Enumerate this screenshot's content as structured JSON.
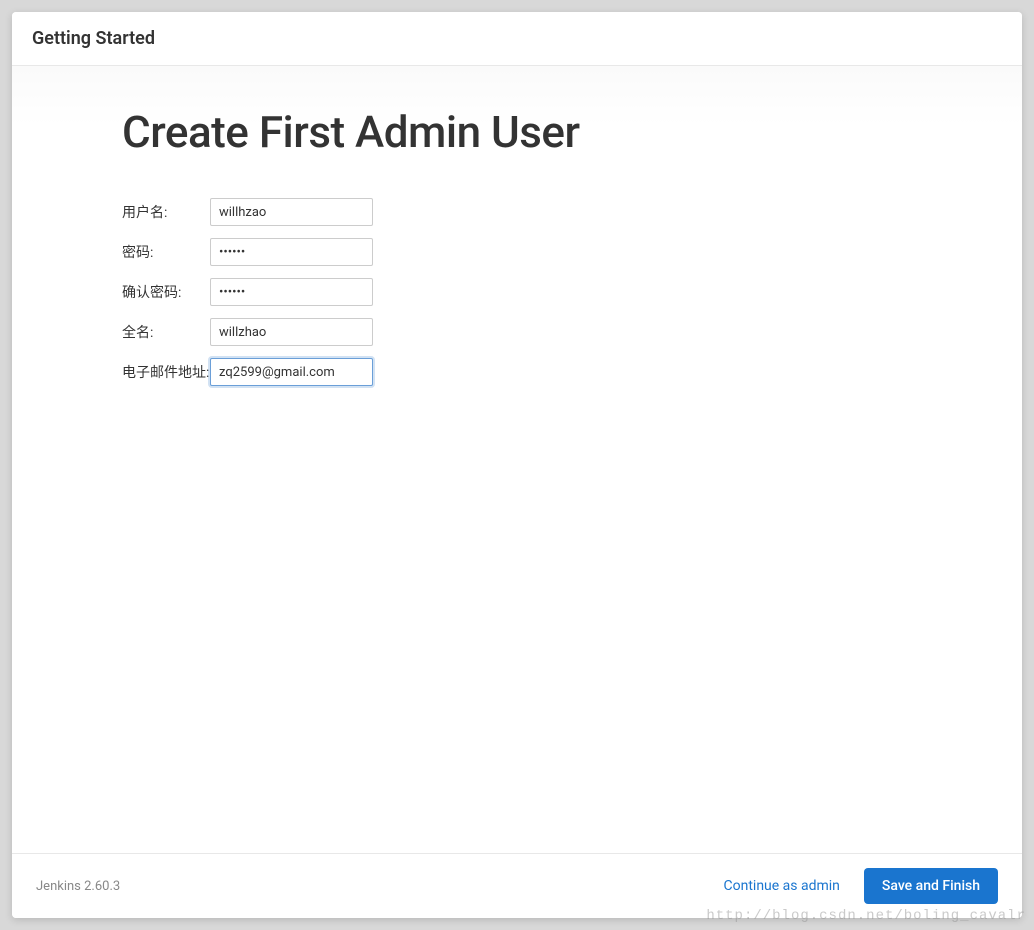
{
  "header": {
    "title": "Getting Started"
  },
  "main": {
    "title": "Create First Admin User",
    "fields": {
      "username": {
        "label": "用户名:",
        "value": "willhzao"
      },
      "password": {
        "label": "密码:",
        "value": "••••••"
      },
      "confirm_password": {
        "label": "确认密码:",
        "value": "••••••"
      },
      "fullname": {
        "label": "全名:",
        "value": "willzhao"
      },
      "email": {
        "label": "电子邮件地址:",
        "value": "zq2599@gmail.com"
      }
    }
  },
  "footer": {
    "version": "Jenkins 2.60.3",
    "continue_label": "Continue as admin",
    "save_label": "Save and Finish"
  },
  "watermark": "http://blog.csdn.net/boling_cavalr"
}
